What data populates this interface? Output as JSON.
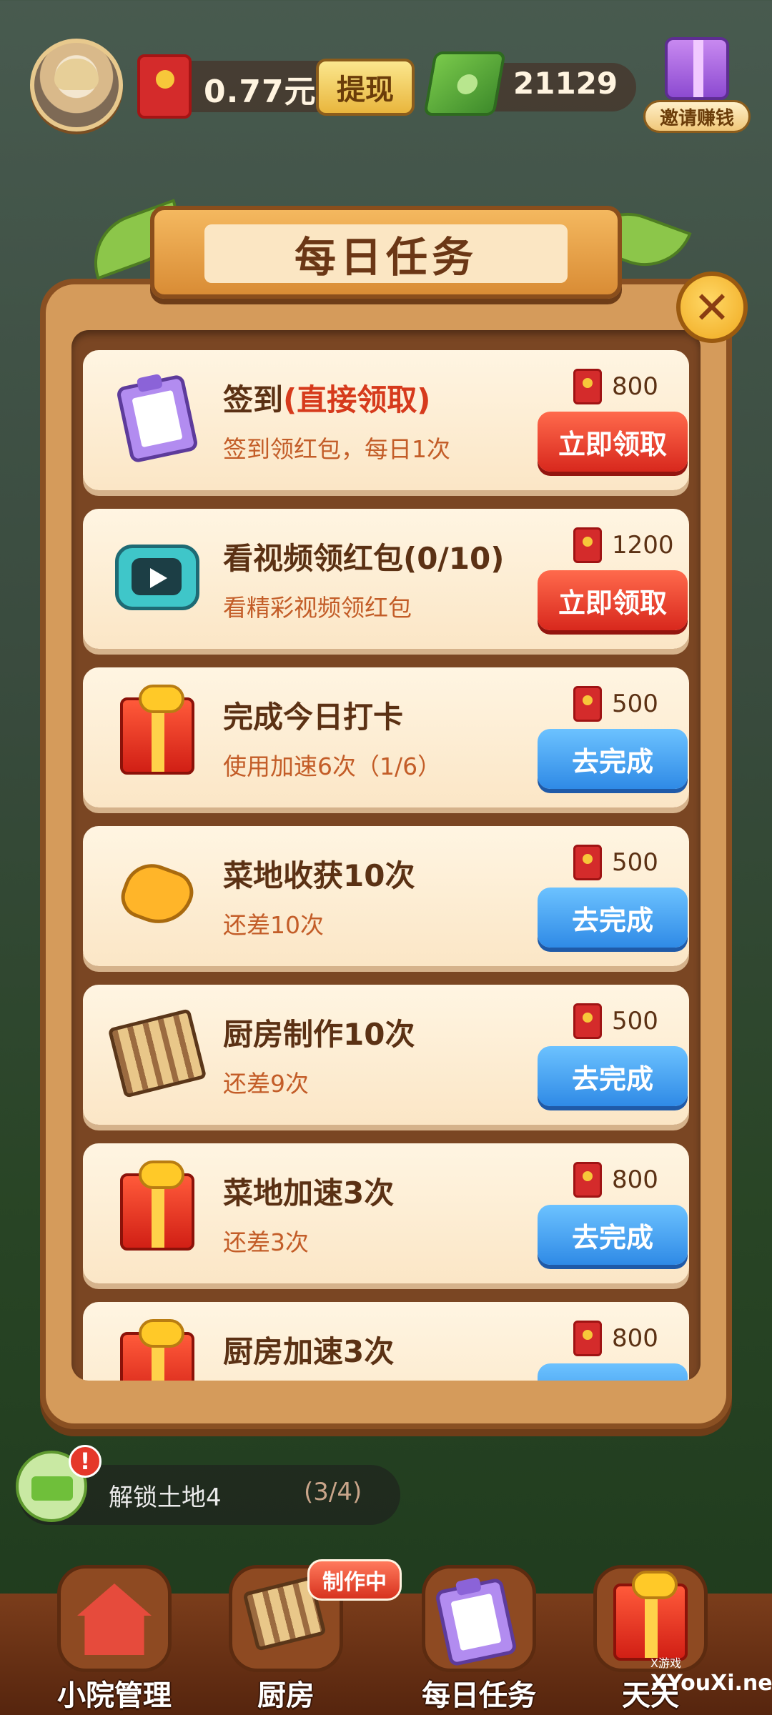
{
  "topbar": {
    "money": "0.77元",
    "withdraw_label": "提现",
    "coins": "21129",
    "invite_label": "邀请赚钱"
  },
  "dialog": {
    "title": "每日任务",
    "close_symbol": "✕",
    "tasks": [
      {
        "title_prefix": "签到",
        "title_highlight": "(直接领取)",
        "subtitle": "签到领红包，每日1次",
        "reward": "800",
        "button": "立即领取",
        "button_style": "red",
        "icon": "clipboard-icon"
      },
      {
        "title_prefix": "看视频领红包(0/10)",
        "title_highlight": "",
        "subtitle": "看精彩视频领红包",
        "reward": "1200",
        "button": "立即领取",
        "button_style": "red",
        "icon": "tv-icon"
      },
      {
        "title_prefix": "完成今日打卡",
        "title_highlight": "",
        "subtitle": "使用加速6次（1/6）",
        "reward": "500",
        "button": "去完成",
        "button_style": "blue",
        "icon": "gift-icon"
      },
      {
        "title_prefix": "菜地收获10次",
        "title_highlight": "",
        "subtitle": "还差10次",
        "reward": "500",
        "button": "去完成",
        "button_style": "blue",
        "icon": "hand-icon"
      },
      {
        "title_prefix": "厨房制作10次",
        "title_highlight": "",
        "subtitle": "还差9次",
        "reward": "500",
        "button": "去完成",
        "button_style": "blue",
        "icon": "grill-icon"
      },
      {
        "title_prefix": "菜地加速3次",
        "title_highlight": "",
        "subtitle": "还差3次",
        "reward": "800",
        "button": "去完成",
        "button_style": "blue",
        "icon": "gift-icon"
      },
      {
        "title_prefix": "厨房加速3次",
        "title_highlight": "",
        "subtitle": "",
        "reward": "800",
        "button": "",
        "button_style": "blue",
        "icon": "gift-icon"
      }
    ]
  },
  "unlock": {
    "text": "解锁土地4",
    "count": "(3/4)",
    "alert": "!"
  },
  "nav": {
    "items": [
      {
        "label": "小院管理",
        "icon": "house-icon"
      },
      {
        "label": "厨房",
        "icon": "grill-icon",
        "badge": "制作中"
      },
      {
        "label": "每日任务",
        "icon": "clipboard-icon"
      },
      {
        "label": "天天",
        "icon": "gift-icon"
      }
    ]
  },
  "watermark": {
    "site": "XYouXi.net",
    "logo_text": "X游戏"
  }
}
